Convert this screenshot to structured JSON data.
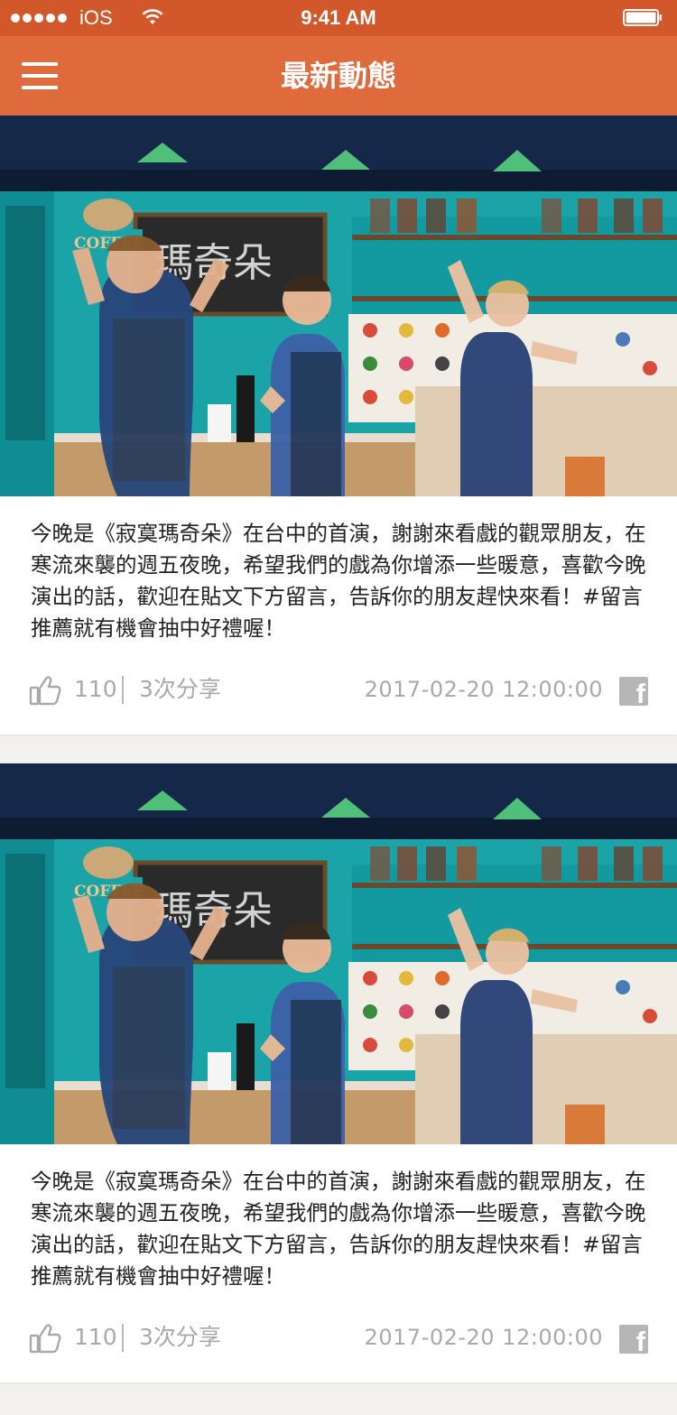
{
  "status_bar": {
    "carrier": "iOS",
    "time": "9:41 AM"
  },
  "nav": {
    "title": "最新動態"
  },
  "posts": [
    {
      "image_alt": "舞台劇《寂寞瑪奇朵》劇照",
      "stage_sign": "COFFEE",
      "board_text": "瑪奇朵",
      "text": "今晚是《寂寞瑪奇朵》在台中的首演，謝謝來看戲的觀眾朋友，在寒流來襲的週五夜晚，希望我們的戲為你增添一些暖意，喜歡今晚演出的話，歡迎在貼文下方留言，告訴你的朋友趕快來看！#留言推薦就有機會抽中好禮喔！",
      "likes": "110",
      "shares": "3次分享",
      "timestamp": "2017-02-20 12:00:00"
    },
    {
      "image_alt": "舞台劇《寂寞瑪奇朵》劇照",
      "stage_sign": "COFFEE",
      "board_text": "瑪奇朵",
      "text": "今晚是《寂寞瑪奇朵》在台中的首演，謝謝來看戲的觀眾朋友，在寒流來襲的週五夜晚，希望我們的戲為你增添一些暖意，喜歡今晚演出的話，歡迎在貼文下方留言，告訴你的朋友趕快來看！#留言推薦就有機會抽中好禮喔！",
      "likes": "110",
      "shares": "3次分享",
      "timestamp": "2017-02-20 12:00:00"
    }
  ],
  "icons": {
    "menu": "hamburger-menu-icon",
    "like": "thumbs-up-icon",
    "share": "facebook-icon"
  },
  "colors": {
    "status_bar": "#d2582c",
    "nav_bar": "#df6a3c",
    "meta_text": "#a9a9a9",
    "background": "#f3f1ee"
  }
}
